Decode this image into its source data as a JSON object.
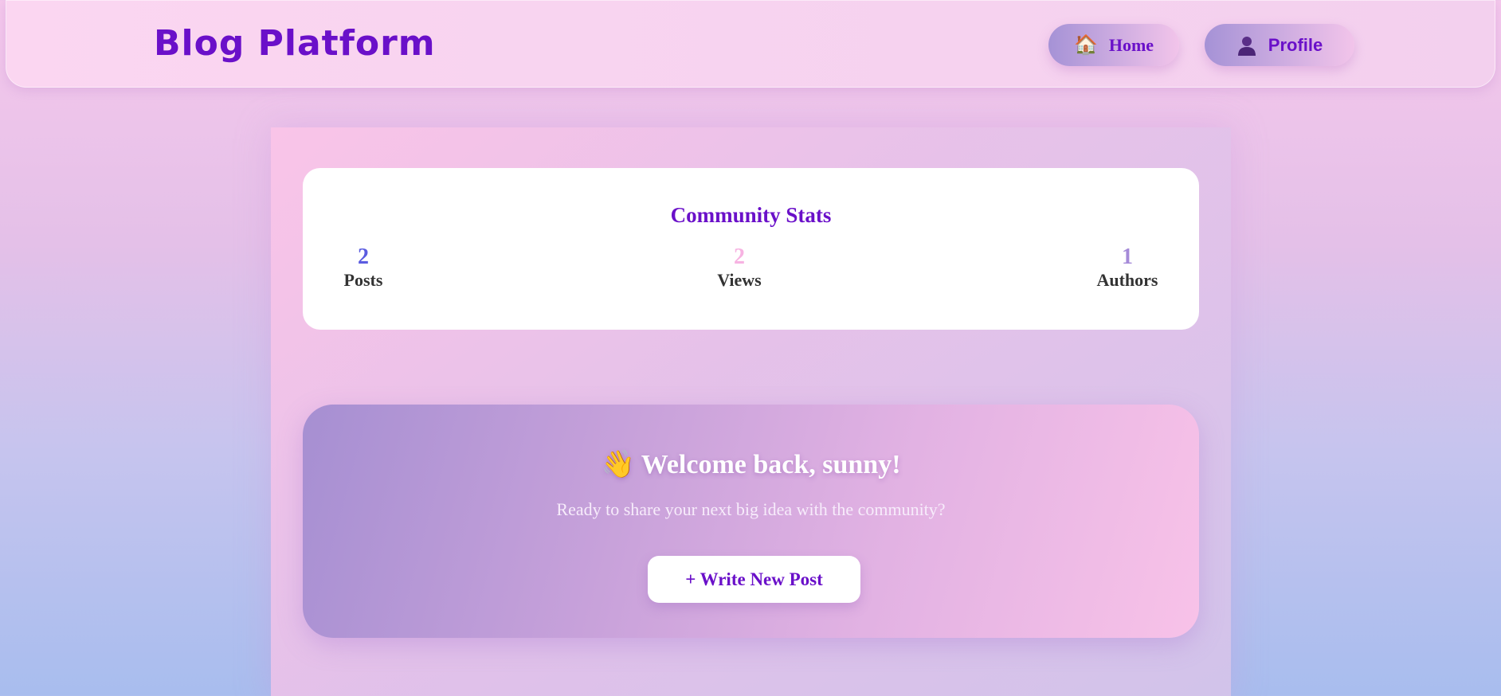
{
  "navbar": {
    "brand": "Blog Platform",
    "home": {
      "icon": "🏠",
      "icon_name": "house-icon",
      "label": "Home"
    },
    "profile": {
      "icon_name": "user-silhouette-icon",
      "label": "Profile"
    }
  },
  "stats": {
    "title": "Community Stats",
    "items": [
      {
        "value": "2",
        "label": "Posts",
        "color": "#5b5ce0"
      },
      {
        "value": "2",
        "label": "Views",
        "color": "#f7b3e2"
      },
      {
        "value": "1",
        "label": "Authors",
        "color": "#a58ad8"
      }
    ]
  },
  "welcome": {
    "emoji": "👋",
    "emoji_name": "waving-hand-icon",
    "title": "Welcome back, sunny!",
    "subtitle": "Ready to share your next big idea with the community?",
    "button_label": "+ Write New Post"
  },
  "colors": {
    "accent": "#6a10c9"
  }
}
